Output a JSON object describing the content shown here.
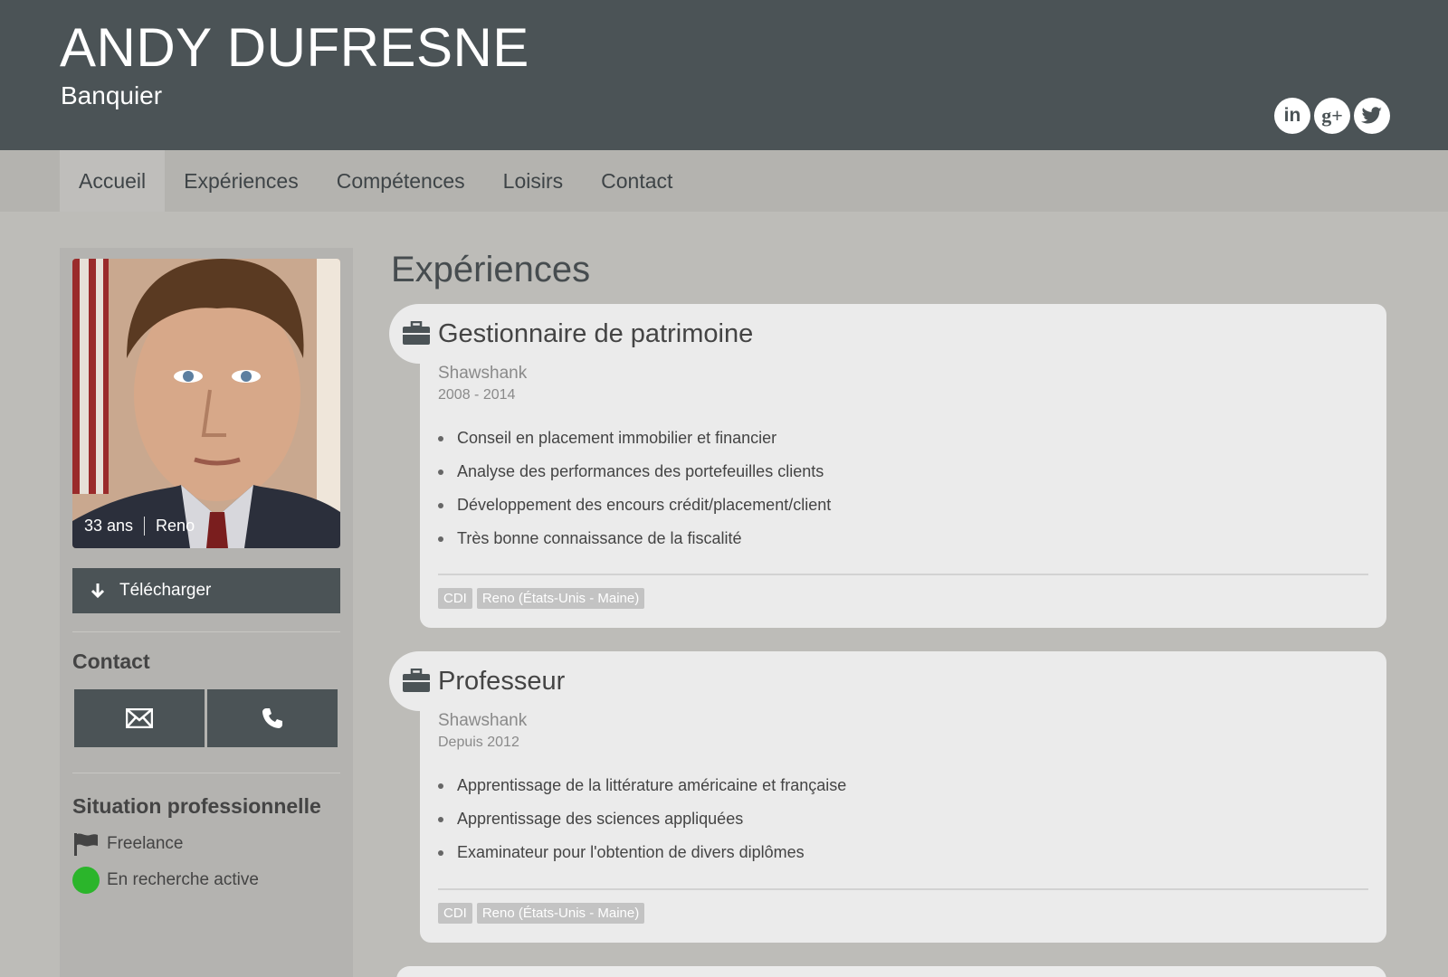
{
  "header": {
    "name": "ANDY DUFRESNE",
    "job_title": "Banquier",
    "social": [
      {
        "icon": "linkedin-icon",
        "glyph": "in"
      },
      {
        "icon": "google-plus-icon",
        "glyph": "g+"
      },
      {
        "icon": "twitter-icon",
        "glyph": ""
      }
    ]
  },
  "nav": {
    "items": [
      "Accueil",
      "Expériences",
      "Compétences",
      "Loisirs",
      "Contact"
    ],
    "active": "Accueil"
  },
  "sidebar": {
    "photo_caption": {
      "age": "33 ans",
      "city": "Reno"
    },
    "download_label": "Télécharger",
    "contact_heading": "Contact",
    "situation_heading": "Situation professionnelle",
    "status": [
      {
        "icon": "flag-icon",
        "label": "Freelance"
      },
      {
        "icon": "green-dot-icon",
        "label": "En recherche active"
      }
    ]
  },
  "main": {
    "section_title": "Expériences",
    "experiences": [
      {
        "title": "Gestionnaire de patrimoine",
        "company": "Shawshank",
        "dates": "2008 - 2014",
        "tasks": [
          "Conseil en placement immobilier et financier",
          "Analyse des performances des portefeuilles clients",
          "Développement des encours crédit/placement/client",
          "Très bonne connaissance de la fiscalité"
        ],
        "tags": [
          "CDI",
          "Reno (États-Unis - Maine)"
        ]
      },
      {
        "title": "Professeur",
        "company": "Shawshank",
        "dates": "Depuis 2012",
        "tasks": [
          "Apprentissage de la littérature américaine et française",
          "Apprentissage des sciences appliquées",
          "Examinateur pour l'obtention de divers diplômes"
        ],
        "tags": [
          "CDI",
          "Reno (États-Unis - Maine)"
        ]
      }
    ]
  },
  "colors": {
    "header_bg": "#4b5356",
    "page_bg": "#bdbcb8",
    "card_bg": "#ebebeb",
    "status_green": "#2bb52b"
  }
}
